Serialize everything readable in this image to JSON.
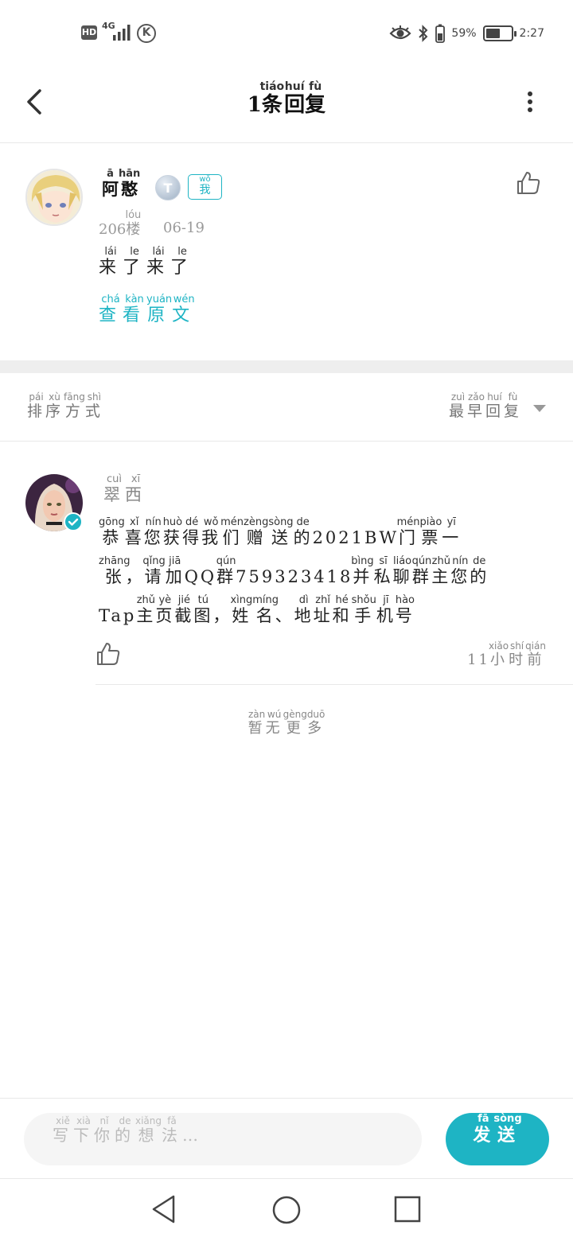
{
  "status_bar": {
    "hd": "HD",
    "network": "4G",
    "carrier_icon": "K",
    "battery_percent": "59%",
    "battery_level": 0.59,
    "time": "2:27"
  },
  "header": {
    "title_prefix": "1",
    "title_chars": [
      [
        "条",
        "tiáo"
      ],
      [
        "回",
        "huí"
      ],
      [
        "复",
        "fù"
      ]
    ]
  },
  "post": {
    "author_chars": [
      [
        "阿",
        "ā"
      ],
      [
        "憨",
        "hān"
      ]
    ],
    "badge_level": "T",
    "badge_me_char": [
      "我",
      "wǒ"
    ],
    "floor_number": "206",
    "floor_char": [
      "楼",
      "lóu"
    ],
    "date": "06-19",
    "text_chars": [
      [
        "来",
        "lái"
      ],
      [
        "了",
        "le"
      ],
      [
        "来",
        "lái"
      ],
      [
        "了",
        "le"
      ]
    ],
    "view_original_chars": [
      [
        "查",
        "chá"
      ],
      [
        "看",
        "kàn"
      ],
      [
        "原",
        "yuán"
      ],
      [
        "文",
        "wén"
      ]
    ]
  },
  "sort": {
    "label_chars": [
      [
        "排",
        "pái"
      ],
      [
        "序",
        "xù"
      ],
      [
        "方",
        "fāng"
      ],
      [
        "式",
        "shì"
      ]
    ],
    "value_chars": [
      [
        "最",
        "zuì"
      ],
      [
        "早",
        "zǎo"
      ],
      [
        "回",
        "huí"
      ],
      [
        "复",
        "fù"
      ]
    ]
  },
  "reply": {
    "author_chars": [
      [
        "翠",
        "cuì"
      ],
      [
        "西",
        "xī"
      ]
    ],
    "lines": [
      [
        [
          "恭",
          "gōng"
        ],
        [
          "喜",
          "xǐ"
        ],
        [
          "您",
          "nín"
        ],
        [
          "获",
          "huò"
        ],
        [
          "得",
          "dé"
        ],
        [
          "我",
          "wǒ"
        ],
        [
          "们",
          "mén"
        ],
        [
          "赠",
          "zèng"
        ],
        [
          "送",
          "sòng"
        ],
        [
          "的",
          "de"
        ],
        [
          "2021BW",
          ""
        ],
        [
          "门",
          "mén"
        ],
        [
          "票",
          "piào"
        ],
        [
          "一",
          "yī"
        ]
      ],
      [
        [
          "张",
          "zhāng"
        ],
        [
          "，",
          ""
        ],
        [
          "请",
          "qǐng"
        ],
        [
          "加",
          "jiā"
        ],
        [
          "QQ",
          ""
        ],
        [
          "群",
          "qún"
        ],
        [
          "759323418",
          ""
        ],
        [
          "并",
          "bìng"
        ],
        [
          "私",
          "sī"
        ],
        [
          "聊",
          "liáo"
        ],
        [
          "群",
          "qún"
        ],
        [
          "主",
          "zhǔ"
        ],
        [
          "您",
          "nín"
        ],
        [
          "的",
          "de"
        ]
      ],
      [
        [
          "Tap",
          ""
        ],
        [
          "主",
          "zhǔ"
        ],
        [
          "页",
          "yè"
        ],
        [
          "截",
          "jié"
        ],
        [
          "图",
          "tú"
        ],
        [
          "，",
          ""
        ],
        [
          "姓",
          "xìng"
        ],
        [
          "名",
          "míng"
        ],
        [
          "、",
          ""
        ],
        [
          "地",
          "dì"
        ],
        [
          "址",
          "zhǐ"
        ],
        [
          "和",
          "hé"
        ],
        [
          "手",
          "shǒu"
        ],
        [
          "机",
          "jī"
        ],
        [
          "号",
          "hào"
        ]
      ]
    ],
    "time_number": "11",
    "time_chars": [
      [
        "小",
        "xiǎo"
      ],
      [
        "时",
        "shí"
      ],
      [
        "前",
        "qián"
      ]
    ]
  },
  "no_more_chars": [
    [
      "暂",
      "zàn"
    ],
    [
      "无",
      "wú"
    ],
    [
      "更",
      "gèng"
    ],
    [
      "多",
      "duō"
    ]
  ],
  "composer": {
    "placeholder_chars": [
      [
        "写",
        "xiě"
      ],
      [
        "下",
        "xià"
      ],
      [
        "你",
        "nǐ"
      ],
      [
        "的",
        "de"
      ],
      [
        "想",
        "xiǎng"
      ],
      [
        "法",
        "fǎ"
      ]
    ],
    "placeholder_suffix": "…",
    "send_chars": [
      [
        "发",
        "fā"
      ],
      [
        "送",
        "sòng"
      ]
    ]
  },
  "colors": {
    "accent": "#1eb4c4",
    "muted_text": "#888888",
    "divider": "#eeeeee"
  }
}
